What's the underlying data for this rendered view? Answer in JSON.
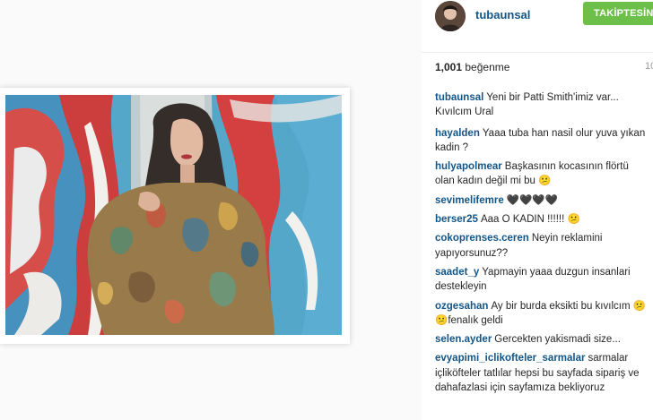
{
  "post": {
    "username": "tubaunsal",
    "follow_label": "TAKİPTESİN",
    "likes_count": "1,001",
    "likes_unit": "beğenme",
    "time_ago": "10",
    "caption": {
      "user": "tubaunsal",
      "text": "Yeni bir Patti Smith'imiz var... Kıvılcım Ural"
    }
  },
  "comments": [
    {
      "user": "hayalden",
      "text": "Yaaa tuba han nasil olur yuva yıkan kadin ?"
    },
    {
      "user": "hulyapolmear",
      "text": "Başkasının kocasının flörtü olan kadın değil mi bu 😕"
    },
    {
      "user": "sevimelifemre",
      "text": "🖤🖤🖤🖤"
    },
    {
      "user": "berser25",
      "text": "Aaa O KADIN !!!!!! 😕"
    },
    {
      "user": "cokoprenses.ceren",
      "text": "Neyin reklamini yapıyorsunuz??"
    },
    {
      "user": "saadet_y",
      "text": "Yapmayin yaaa duzgun insanlari destekleyin"
    },
    {
      "user": "ozgesahan",
      "text": "Ay bir burda eksikti bu kıvılcım 😕😕fenalık geldi"
    },
    {
      "user": "selen.ayder",
      "text": "Gercekten yakismadi size..."
    },
    {
      "user": "evyapimi_iclikofteler_sarmalar",
      "text": "sarmalar içliköfteler tatlılar hepsi bu sayfada sipariş ve dahafazlasi için sayfamıza bekliyoruz"
    }
  ],
  "colors": {
    "username": "#125688",
    "follow_button": "#6cc04a",
    "text": "#262626"
  }
}
